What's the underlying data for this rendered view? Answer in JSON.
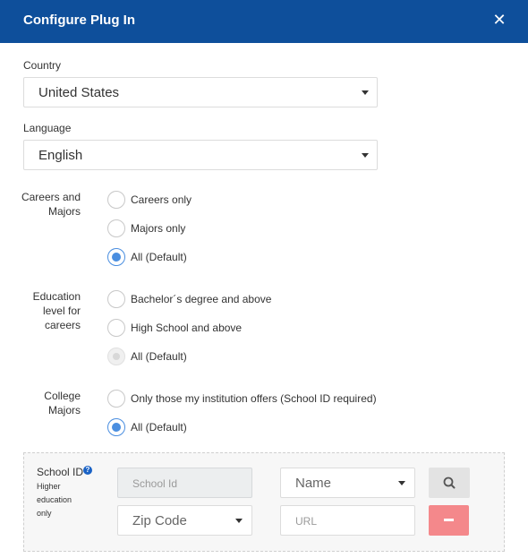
{
  "header": {
    "title": "Configure Plug In",
    "close_icon": "close-icon"
  },
  "country": {
    "label": "Country",
    "selected": "United States"
  },
  "language": {
    "label": "Language",
    "selected": "English"
  },
  "careers_majors": {
    "label": "Careers and Majors",
    "label_lines": [
      "Careers and",
      "Majors"
    ],
    "options": [
      {
        "label": "Careers only",
        "checked": false
      },
      {
        "label": "Majors only",
        "checked": false
      },
      {
        "label": "All (Default)",
        "checked": true
      }
    ]
  },
  "education_level": {
    "label_lines": [
      "Education",
      "level for",
      "careers"
    ],
    "options": [
      {
        "label": "Bachelor´s degree and above",
        "checked": false
      },
      {
        "label": "High School and above",
        "checked": false
      },
      {
        "label": "All (Default)",
        "checked": true,
        "disabled": true
      }
    ]
  },
  "college_majors": {
    "label_lines": [
      "College",
      "Majors"
    ],
    "options": [
      {
        "label": "Only those my institution offers (School ID required)",
        "checked": false
      },
      {
        "label": "All (Default)",
        "checked": true
      }
    ]
  },
  "school": {
    "title": "School ID",
    "help_icon": "help-icon",
    "subtitle_lines": [
      "Higher",
      "education",
      "only"
    ],
    "school_id_placeholder": "School Id",
    "name_select": "Name",
    "zip_select": "Zip Code",
    "url_placeholder": "URL",
    "search_icon": "search-icon",
    "remove_icon": "minus-icon"
  },
  "colors": {
    "header": "#0e4f9b",
    "radio_checked": "#4a8ee0",
    "remove_button": "#f4888b"
  }
}
